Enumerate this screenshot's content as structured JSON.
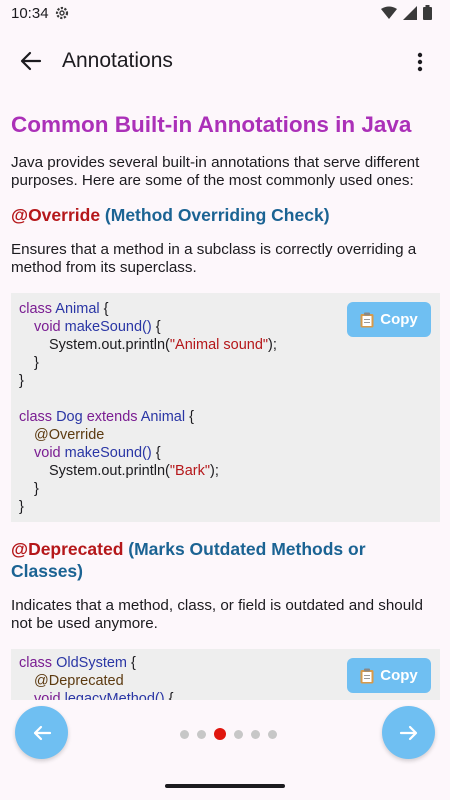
{
  "status_bar": {
    "time": "10:34"
  },
  "app_bar": {
    "title": "Annotations"
  },
  "content": {
    "heading": "Common Built-in Annotations in Java",
    "intro_lines": [
      "Java provides several built-in annotations that serve different",
      "purposes. Here are some of the most commonly used ones:"
    ],
    "sections": [
      {
        "annotation": "@Override",
        "title": "(Method Overriding Check)",
        "desc_lines": [
          "Ensures that a method in a subclass is correctly overriding a",
          "method from its superclass."
        ],
        "copy_label": "Copy"
      },
      {
        "annotation": "@Deprecated",
        "title_line1": "(Marks Outdated Methods or",
        "title_line2": "Classes)",
        "desc_lines": [
          "Indicates that a method, class, or field is outdated and should",
          "not be used anymore."
        ],
        "copy_label": "Copy"
      }
    ],
    "code1": {
      "l1a": "class",
      "l1b": "Animal",
      "l1c": "{",
      "l2a": "void",
      "l2b": "makeSound()",
      "l2c": "{",
      "l3a": "System.out.println(",
      "l3b": "\"Animal sound\"",
      "l3c": ");",
      "l4": "}",
      "l5": "}",
      "l7a": "class",
      "l7b": "Dog",
      "l7c": "extends",
      "l7d": "Animal",
      "l7e": "{",
      "l8": "@Override",
      "l9a": "void",
      "l9b": "makeSound()",
      "l9c": "{",
      "l10a": "System.out.println(",
      "l10b": "\"Bark\"",
      "l10c": ");",
      "l11": "}",
      "l12": "}"
    },
    "code2": {
      "l1a": "class",
      "l1b": "OldSystem",
      "l1c": "{",
      "l2": "@Deprecated",
      "l3a": "void",
      "l3b": "legacyMethod()",
      "l3c": "{"
    }
  },
  "pagination": {
    "total": 6,
    "active_index": 2
  },
  "colors": {
    "accent": "#6fbff2",
    "heading": "#ab30b8",
    "subheading": "#1b6393",
    "annotation": "#b5171a",
    "active_dot": "#e0160e"
  }
}
